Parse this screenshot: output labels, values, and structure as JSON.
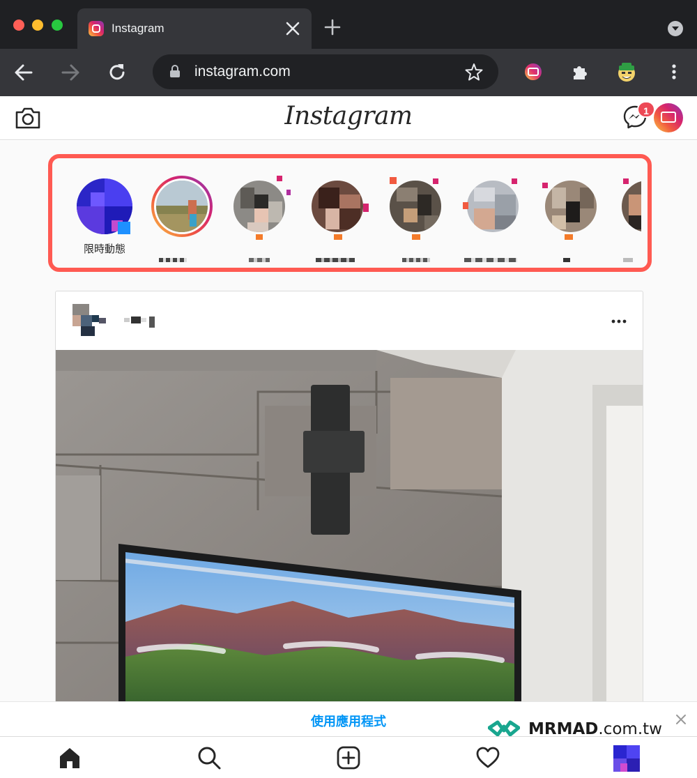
{
  "browser": {
    "tab_title": "Instagram",
    "url": "instagram.com",
    "icons": [
      "back-arrow-icon",
      "forward-arrow-icon",
      "reload-icon",
      "lock-icon",
      "bookmark-star-icon",
      "igtv-extension-icon",
      "puzzle-extension-icon",
      "profile-extension-icon",
      "kebab-menu-icon"
    ]
  },
  "instagram": {
    "logo_text": "Instagram",
    "messenger_badge": "1",
    "stories": [
      {
        "label": "限時動態"
      },
      {
        "label": ""
      },
      {
        "label": ""
      },
      {
        "label": ""
      },
      {
        "label": ""
      },
      {
        "label": ""
      },
      {
        "label": ""
      },
      {
        "label": ""
      }
    ],
    "app_banner": "使用應用程式",
    "watermark_brand": "MRMAD",
    "watermark_domain": ".com.tw",
    "bottom_nav": [
      "home-icon",
      "search-icon",
      "new-post-icon",
      "activity-heart-icon",
      "profile-avatar"
    ]
  },
  "colors": {
    "highlight": "#ff5a52",
    "link_blue": "#0095f6",
    "badge_red": "#ed4956"
  }
}
